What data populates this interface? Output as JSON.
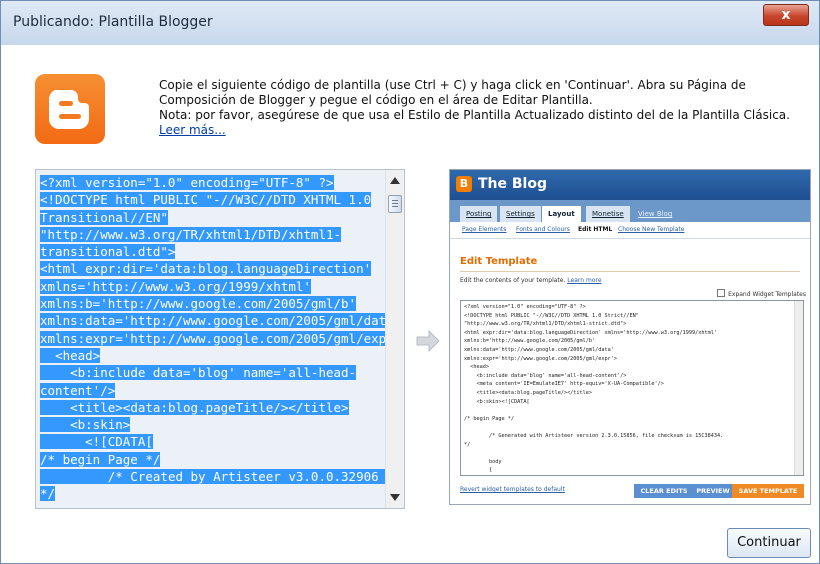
{
  "window": {
    "title": "Publicando: Plantilla Blogger",
    "close_label": "x"
  },
  "intro": {
    "line1": "Copie el siguiente código de plantilla (use Ctrl + C) y haga click en 'Continuar'. Abra su Página de",
    "line2": "Composición de Blogger y pegue el código en el área de Editar Plantilla.",
    "line3": "Nota: por favor, asegúrese de que usa el Estilo de Plantilla Actualizado distinto del de la Plantilla Clásica.",
    "read_more": "Leer más..."
  },
  "template_code": "<?xml version=\"1.0\" encoding=\"UTF-8\" ?>\n<!DOCTYPE html PUBLIC \"-//W3C//DTD XHTML 1.0\nTransitional//EN\"\n\"http://www.w3.org/TR/xhtml1/DTD/xhtml1-\ntransitional.dtd\">\n<html expr:dir='data:blog.languageDirection'\nxmlns='http://www.w3.org/1999/xhtml'\nxmlns:b='http://www.google.com/2005/gml/b'\nxmlns:data='http://www.google.com/2005/gml/data'\nxmlns:expr='http://www.google.com/2005/gml/expr'>\n  <head>\n    <b:include data='blog' name='all-head-content'/>\n    <title><data:blog.pageTitle/></title>\n    <b:skin>\n      <![CDATA[\n/* begin Page */\n         /* Created by Artisteer v3.0.0.32906 */\n\n         #art-main, table\n         {\n            font-family: Arial, Helvetica, Sans-Serif;",
  "preview": {
    "logo_letter": "B",
    "blog_title": "The Blog",
    "tabs": [
      "Posting",
      "Settings",
      "Layout",
      "Monetise",
      "View Blog"
    ],
    "active_tab": "Layout",
    "subtabs": [
      "Page Elements",
      "Fonts and Colours",
      "Edit HTML",
      "Choose New Template"
    ],
    "active_subtab": "Edit HTML",
    "heading": "Edit Template",
    "note_text": "Edit the contents of your template.",
    "note_link": "Learn more",
    "expand_label": "Expand Widget Templates",
    "code": "<?xml version=\"1.0\" encoding=\"UTF-8\" ?>\n<!DOCTYPE html PUBLIC \"-//W3C//DTD XHTML 1.0 Strict//EN\"\n\"http://www.w3.org/TR/xhtml1/DTD/xhtml1-strict.dtd\">\n<html expr:dir='data:blog.languageDirection' xmlns='http://www.w3.org/1999/xhtml'\nxmlns:b='http://www.google.com/2005/gml/b'\nxmlns:data='http://www.google.com/2005/gml/data'\nxmlns:expr='http://www.google.com/2005/gml/expr'>\n  <head>\n    <b:include data='blog' name='all-head-content'/>\n    <meta content='IE=EmulateIE7' http-equiv='X-UA-Compatible'/>\n    <title><data:blog.pageTitle/></title>\n    <b:skin><![CDATA[\n\n/* begin Page */\n\n        /* Generated with Artisteer version 2.3.0.15856, file checksum is 15C38434.\n*/\n\n        body\n        {",
    "revert_link": "Revert widget templates to default",
    "btn_clear": "CLEAR EDITS",
    "btn_preview": "PREVIEW",
    "btn_save": "SAVE TEMPLATE"
  },
  "buttons": {
    "continue": "Continuar"
  },
  "colors": {
    "selection": "#3399ff",
    "blogger_orange": "#f57d00",
    "preview_header": "#2f6aad"
  }
}
